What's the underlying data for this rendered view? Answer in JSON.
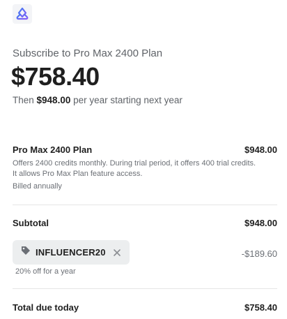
{
  "header": {
    "logo_icon": "brand-logo-icon",
    "subscribe_title": "Subscribe to Pro Max 2400 Plan",
    "price": "$758.40",
    "then_prefix": "Then ",
    "then_amount": "$948.00",
    "then_suffix": " per year starting next year"
  },
  "line_item": {
    "name": "Pro Max 2400 Plan",
    "amount": "$948.00",
    "description": "Offers 2400 credits monthly. During trial period, it offers 400 trial credits. It allows Pro Max Plan feature access.",
    "billing": "Billed annually"
  },
  "subtotal": {
    "label": "Subtotal",
    "amount": "$948.00"
  },
  "promo": {
    "tag_icon": "tag-icon",
    "code": "INFLUENCER20",
    "remove_icon": "close-icon",
    "discount": "-$189.60",
    "note": "20% off for a year"
  },
  "total": {
    "label": "Total due today",
    "amount": "$758.40"
  },
  "colors": {
    "logo_blue": "#3d7bf2",
    "logo_purple": "#8a5cf6",
    "chip_bg": "#eceeef",
    "divider": "#e6e6e6"
  }
}
